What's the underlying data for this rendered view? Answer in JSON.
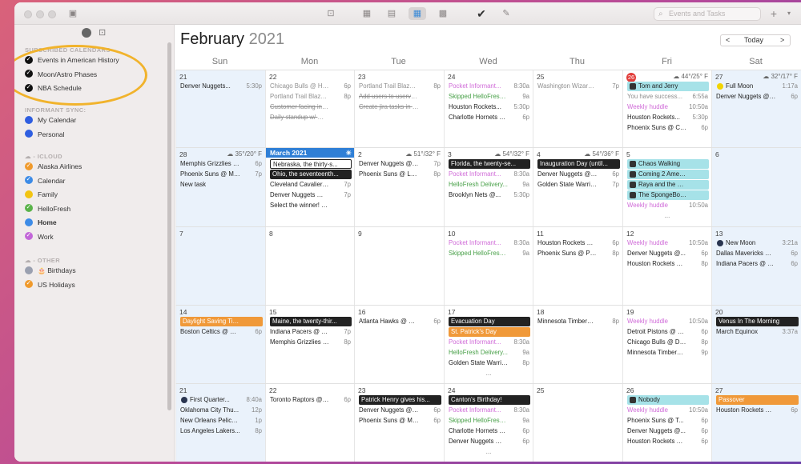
{
  "search": {
    "placeholder": "Events and Tasks"
  },
  "sidebar": {
    "sections": [
      {
        "label": "SUBSCRIBED CALENDARS",
        "items": [
          {
            "label": "Events in American History",
            "color": "#111111",
            "checked": true
          },
          {
            "label": "Moon/Astro Phases",
            "color": "#111111",
            "checked": true
          },
          {
            "label": "NBA Schedule",
            "color": "#111111",
            "checked": true
          }
        ]
      },
      {
        "label": "INFORMANT SYNC:",
        "items": [
          {
            "label": "My Calendar",
            "color": "#2f5ee0",
            "checked": false
          },
          {
            "label": "Personal",
            "color": "#2f5ee0",
            "checked": false
          }
        ]
      },
      {
        "label": "ICLOUD",
        "items": [
          {
            "label": "Alaska Airlines",
            "color": "#f09a2c",
            "checked": true
          },
          {
            "label": "Calendar",
            "color": "#3d8be6",
            "checked": true
          },
          {
            "label": "Family",
            "color": "#f2c412",
            "checked": false
          },
          {
            "label": "HelloFresh",
            "color": "#5ab34a",
            "checked": true
          },
          {
            "label": "Home",
            "color": "#3d8be6",
            "checked": false,
            "bold": true
          },
          {
            "label": "Work",
            "color": "#c266d8",
            "checked": true
          }
        ]
      },
      {
        "label": "OTHER",
        "items": [
          {
            "label": "Birthdays",
            "color": "#9aa0b0",
            "checked": false,
            "icon": "🎂"
          },
          {
            "label": "US Holidays",
            "color": "#f09a2c",
            "checked": true
          }
        ]
      }
    ]
  },
  "header": {
    "month": "February",
    "year": "2021",
    "prev": "<",
    "today": "Today",
    "next": ">"
  },
  "dow": [
    "Sun",
    "Mon",
    "Tue",
    "Wed",
    "Thu",
    "Fri",
    "Sat"
  ],
  "weeks": [
    {
      "days": [
        {
          "num": "21",
          "events": [
            {
              "t": "Denver Nuggets...",
              "tm": "5:30p"
            }
          ]
        },
        {
          "num": "22",
          "events": [
            {
              "t": "Chicago Bulls @ Hou...",
              "tm": "6p",
              "s": "gray"
            },
            {
              "t": "Portland Trail Blazer...",
              "tm": "8p",
              "s": "gray"
            },
            {
              "t": "Customer facing info p...",
              "s": "strike"
            },
            {
              "t": "Daily standup w/ Web...",
              "s": "strike"
            }
          ]
        },
        {
          "num": "23",
          "events": [
            {
              "t": "Portland Trail Blazer...",
              "tm": "8p",
              "s": "gray"
            },
            {
              "t": "Add users to uservoice",
              "s": "strike"
            },
            {
              "t": "Create jira tasks in bac...",
              "s": "strike"
            }
          ]
        },
        {
          "num": "24",
          "events": [
            {
              "t": "Pocket Informant...",
              "tm": "8:30a",
              "s": "pink"
            },
            {
              "t": "Skipped HelloFresh...",
              "tm": "9a",
              "s": "green"
            },
            {
              "t": "Houston Rockets...",
              "tm": "5:30p"
            },
            {
              "t": "Charlotte Hornets @...",
              "tm": "6p"
            }
          ]
        },
        {
          "num": "25",
          "events": [
            {
              "t": "Washington Wizards...",
              "tm": "7p",
              "s": "gray"
            }
          ]
        },
        {
          "num": "26",
          "today": true,
          "wx": "44°/25° F",
          "events": [
            {
              "t": "Tom and Jerry",
              "s": "cyan"
            },
            {
              "t": "You have success...",
              "tm": "6:55a",
              "s": "gray"
            },
            {
              "t": "Weekly huddle",
              "tm": "10:50a",
              "s": "pink"
            },
            {
              "t": "Houston Rockets...",
              "tm": "5:30p"
            },
            {
              "t": "Phoenix Suns @ Chic...",
              "tm": "6p"
            }
          ]
        },
        {
          "num": "27",
          "wx": "32°/17° F",
          "events": [
            {
              "t": "Full Moon",
              "tm": "1:17a",
              "s": "moon",
              "mc": "#f2d400"
            },
            {
              "t": "Denver Nuggets @ O...",
              "tm": "6p"
            }
          ]
        }
      ]
    },
    {
      "days": [
        {
          "num": "28",
          "wx": "35°/20° F",
          "events": [
            {
              "t": "Memphis Grizzlies @...",
              "tm": "6p"
            },
            {
              "t": "Phoenix Suns @ Min...",
              "tm": "7p"
            },
            {
              "t": "New task"
            }
          ]
        },
        {
          "num": "March 2021",
          "march": true,
          "events": [
            {
              "t": "Nebraska, the thirty-s...",
              "s": "blackout"
            },
            {
              "t": "Ohio, the seventeenth...",
              "s": "black"
            },
            {
              "t": "Cleveland Cavaliers...",
              "tm": "7p"
            },
            {
              "t": "Denver Nuggets @ C...",
              "tm": "7p"
            },
            {
              "t": "Select the winner! 🏆 🎉"
            }
          ]
        },
        {
          "num": "2",
          "wx": "51°/32° F",
          "events": [
            {
              "t": "Denver Nuggets @ Ne...",
              "tm": "7p"
            },
            {
              "t": "Phoenix Suns @ Los...",
              "tm": "8p"
            }
          ]
        },
        {
          "num": "3",
          "wx": "54°/32° F",
          "events": [
            {
              "t": "Florida, the twenty-se...",
              "s": "black"
            },
            {
              "t": "Pocket Informant...",
              "tm": "8:30a",
              "s": "pink"
            },
            {
              "t": "HelloFresh Delivery...",
              "tm": "9a",
              "s": "green"
            },
            {
              "t": "Brooklyn Nets @...",
              "tm": "5:30p"
            }
          ]
        },
        {
          "num": "4",
          "wx": "54°/36° F",
          "events": [
            {
              "t": "Inauguration Day (until...",
              "s": "black"
            },
            {
              "t": "Denver Nuggets @ In...",
              "tm": "6p"
            },
            {
              "t": "Golden State Warrior...",
              "tm": "7p"
            }
          ]
        },
        {
          "num": "5",
          "events": [
            {
              "t": "Chaos Walking",
              "s": "cyan"
            },
            {
              "t": "Coming 2 America...",
              "s": "cyan"
            },
            {
              "t": "Raya and the Last...",
              "s": "cyan"
            },
            {
              "t": "The SpongeBob M...",
              "s": "cyan"
            },
            {
              "t": "Weekly huddle",
              "tm": "10:50a",
              "s": "pink"
            }
          ],
          "more": "..."
        },
        {
          "num": "6",
          "events": []
        }
      ]
    },
    {
      "days": [
        {
          "num": "7",
          "events": []
        },
        {
          "num": "8",
          "events": []
        },
        {
          "num": "9",
          "events": []
        },
        {
          "num": "10",
          "events": [
            {
              "t": "Pocket Informant...",
              "tm": "8:30a",
              "s": "pink"
            },
            {
              "t": "Skipped HelloFresh...",
              "tm": "9a",
              "s": "green"
            }
          ]
        },
        {
          "num": "11",
          "events": [
            {
              "t": "Houston Rockets @...",
              "tm": "6p"
            },
            {
              "t": "Phoenix Suns @ Port...",
              "tm": "8p"
            }
          ]
        },
        {
          "num": "12",
          "events": [
            {
              "t": "Weekly huddle",
              "tm": "10:50a",
              "s": "pink"
            },
            {
              "t": "Denver Nuggets @...",
              "tm": "6p"
            },
            {
              "t": "Houston Rockets @...",
              "tm": "8p"
            }
          ]
        },
        {
          "num": "13",
          "events": [
            {
              "t": "New Moon",
              "tm": "3:21a",
              "s": "moon",
              "mc": "#2a3550"
            },
            {
              "t": "Dallas Mavericks @...",
              "tm": "6p"
            },
            {
              "t": "Indiana Pacers @ Ph...",
              "tm": "6p"
            }
          ]
        }
      ]
    },
    {
      "days": [
        {
          "num": "14",
          "events": [
            {
              "t": "Daylight Saving Time",
              "s": "orange"
            },
            {
              "t": "Boston Celtics @ Ho...",
              "tm": "6p"
            }
          ]
        },
        {
          "num": "15",
          "events": [
            {
              "t": "Maine, the twenty-thir...",
              "s": "black"
            },
            {
              "t": "Indiana Pacers @ De...",
              "tm": "7p"
            },
            {
              "t": "Memphis Grizzlies @...",
              "tm": "8p"
            }
          ]
        },
        {
          "num": "16",
          "events": [
            {
              "t": "Atlanta Hawks @ Ho...",
              "tm": "6p"
            }
          ]
        },
        {
          "num": "17",
          "events": [
            {
              "t": "Evacuation Day",
              "s": "black"
            },
            {
              "t": "St. Patrick's Day",
              "s": "orange"
            },
            {
              "t": "Pocket Informant...",
              "tm": "8:30a",
              "s": "pink"
            },
            {
              "t": "HelloFresh Delivery...",
              "tm": "9a",
              "s": "green"
            },
            {
              "t": "Golden State Warrior...",
              "tm": "8p"
            }
          ],
          "more": "..."
        },
        {
          "num": "18",
          "events": [
            {
              "t": "Minnesota Timberwo...",
              "tm": "8p"
            }
          ]
        },
        {
          "num": "19",
          "events": [
            {
              "t": "Weekly huddle",
              "tm": "10:50a",
              "s": "pink"
            },
            {
              "t": "Detroit Pistons @ Ho...",
              "tm": "6p"
            },
            {
              "t": "Chicago Bulls @ Den...",
              "tm": "8p"
            },
            {
              "t": "Minnesota Timberwo...",
              "tm": "9p"
            }
          ]
        },
        {
          "num": "20",
          "events": [
            {
              "t": "Venus In The Morning",
              "s": "black"
            },
            {
              "t": "March Equinox",
              "tm": "3:37a"
            }
          ]
        }
      ]
    },
    {
      "days": [
        {
          "num": "21",
          "events": [
            {
              "t": "First Quarter...",
              "tm": "8:40a",
              "s": "moon",
              "mc": "#2a3550"
            },
            {
              "t": "Oklahoma City Thu...",
              "tm": "12p"
            },
            {
              "t": "New Orleans Pelican...",
              "tm": "1p"
            },
            {
              "t": "Los Angeles Lakers...",
              "tm": "8p"
            }
          ]
        },
        {
          "num": "22",
          "events": [
            {
              "t": "Toronto Raptors @ H...",
              "tm": "6p"
            }
          ]
        },
        {
          "num": "23",
          "events": [
            {
              "t": "Patrick Henry gives his...",
              "s": "black"
            },
            {
              "t": "Denver Nuggets @ O...",
              "tm": "6p"
            },
            {
              "t": "Phoenix Suns @ Mia...",
              "tm": "6p"
            }
          ]
        },
        {
          "num": "24",
          "events": [
            {
              "t": "Canton's Birthday!",
              "s": "black"
            },
            {
              "t": "Pocket Informant...",
              "tm": "8:30a",
              "s": "pink"
            },
            {
              "t": "Skipped HelloFresh...",
              "tm": "9a",
              "s": "green"
            },
            {
              "t": "Charlotte Hornets @...",
              "tm": "6p"
            },
            {
              "t": "Denver Nuggets @ T...",
              "tm": "6p"
            }
          ],
          "more": "..."
        },
        {
          "num": "25",
          "events": []
        },
        {
          "num": "26",
          "events": [
            {
              "t": "Nobody",
              "s": "cyan"
            },
            {
              "t": "Weekly huddle",
              "tm": "10:50a",
              "s": "pink"
            },
            {
              "t": "Phoenix Suns @ T...",
              "tm": "6p"
            },
            {
              "t": "Denver Nuggets @...",
              "tm": "6p"
            },
            {
              "t": "Houston Rockets @...",
              "tm": "6p"
            }
          ]
        },
        {
          "num": "27",
          "events": [
            {
              "t": "Passover",
              "s": "orange"
            },
            {
              "t": "Houston Rockets @...",
              "tm": "6p"
            }
          ]
        }
      ]
    }
  ]
}
